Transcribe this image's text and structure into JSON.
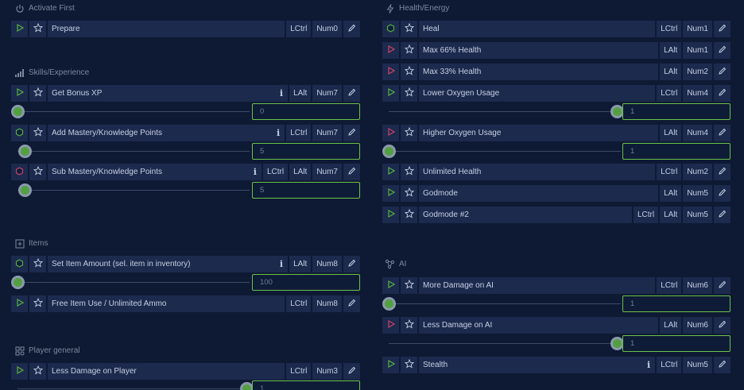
{
  "left": {
    "activate_title": "Activate First",
    "skills_title": "Skills/Experience",
    "items_title": "Items",
    "player_title": "Player general",
    "rows": {
      "prepare": {
        "label": "Prepare",
        "keys": [
          "LCtrl",
          "Num0"
        ]
      },
      "bonus_xp": {
        "label": "Get Bonus XP",
        "keys": [
          "LAlt",
          "Num7"
        ],
        "info": "i"
      },
      "add_mastery": {
        "label": "Add Mastery/Knowledge Points",
        "keys": [
          "LCtrl",
          "Num7"
        ],
        "info": "i"
      },
      "sub_mastery": {
        "label": "Sub Mastery/Knowledge Points",
        "keys": [
          "LCtrl",
          "LAlt",
          "Num7"
        ],
        "info": "i"
      },
      "set_item": {
        "label": "Set Item Amount (sel. item in inventory)",
        "keys": [
          "LAlt",
          "Num8"
        ],
        "info": "i"
      },
      "free_item": {
        "label": "Free Item Use / Unlimited Ammo",
        "keys": [
          "LCtrl",
          "Num8"
        ]
      },
      "less_dmg_player": {
        "label": "Less Damage on Player",
        "keys": [
          "LCtrl",
          "Num3"
        ]
      }
    },
    "sliders": {
      "bonus_xp": "0",
      "add_mastery": "5",
      "sub_mastery": "5",
      "set_item": "100",
      "less_dmg_player": "1"
    }
  },
  "right": {
    "health_title": "Health/Energy",
    "ai_title": "AI",
    "rows": {
      "heal": {
        "label": "Heal",
        "keys": [
          "LCtrl",
          "Num1"
        ]
      },
      "max66": {
        "label": "Max 66% Health",
        "keys": [
          "LAlt",
          "Num1"
        ]
      },
      "max33": {
        "label": "Max 33% Health",
        "keys": [
          "LAlt",
          "Num2"
        ]
      },
      "lower_oxy": {
        "label": "Lower Oxygen Usage",
        "keys": [
          "LCtrl",
          "Num4"
        ]
      },
      "higher_oxy": {
        "label": "Higher Oxygen Usage",
        "keys": [
          "LAlt",
          "Num4"
        ]
      },
      "unlimited_health": {
        "label": "Unlimited Health",
        "keys": [
          "LCtrl",
          "Num2"
        ]
      },
      "godmode": {
        "label": "Godmode",
        "keys": [
          "LAlt",
          "Num5"
        ]
      },
      "godmode2": {
        "label": "Godmode #2",
        "keys": [
          "LCtrl",
          "LAlt",
          "Num5"
        ]
      },
      "more_dmg_ai": {
        "label": "More Damage on AI",
        "keys": [
          "LCtrl",
          "Num6"
        ]
      },
      "less_dmg_ai": {
        "label": "Less Damage on AI",
        "keys": [
          "LAlt",
          "Num6"
        ]
      },
      "stealth": {
        "label": "Stealth",
        "keys": [
          "LCtrl",
          "Num5"
        ],
        "info": "i"
      }
    },
    "sliders": {
      "lower_oxy": "1",
      "higher_oxy": "1",
      "more_dmg_ai": "1",
      "less_dmg_ai": "1"
    }
  },
  "colors": {
    "background": "#0e1a33",
    "cell": "#1b2a4d",
    "accent_green": "#6cc04a",
    "play_green": "#58b040",
    "play_red": "#d0406a",
    "knob_green": "#52a040"
  }
}
